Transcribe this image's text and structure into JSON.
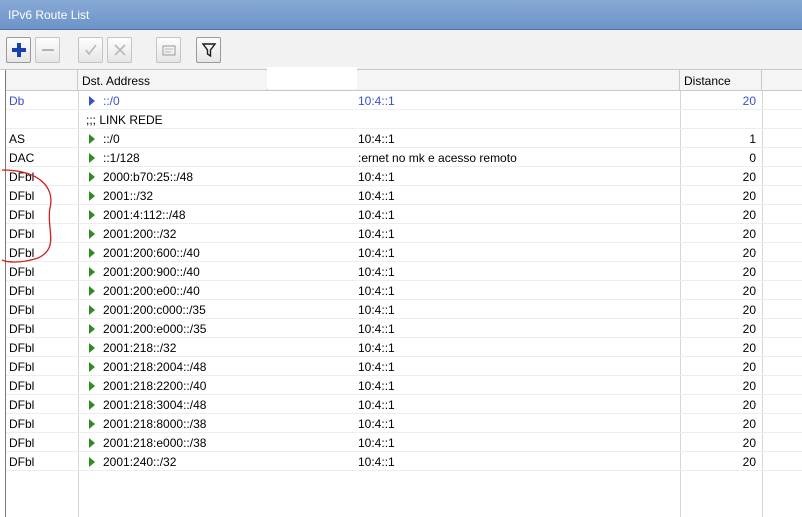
{
  "window": {
    "title": "IPv6 Route List"
  },
  "toolbar": {
    "buttons": [
      {
        "name": "add-button",
        "icon": "plus-icon",
        "enabled": true
      },
      {
        "name": "remove-button",
        "icon": "minus-icon",
        "enabled": false
      },
      {
        "name": "enable-button",
        "icon": "check-icon",
        "enabled": false
      },
      {
        "name": "disable-button",
        "icon": "cross-icon",
        "enabled": false
      },
      {
        "name": "comment-button",
        "icon": "note-icon",
        "enabled": false
      },
      {
        "name": "filter-button",
        "icon": "funnel-icon",
        "enabled": true
      }
    ]
  },
  "table": {
    "headers": {
      "flags": "",
      "dst": "Dst. Address",
      "gateway": "",
      "distance": "Distance"
    },
    "rows": [
      {
        "flags": "Db",
        "dst": "::/0",
        "gateway": "10:4::1",
        "distance": "20",
        "style": "blue"
      },
      {
        "comment": ";;; LINK REDE"
      },
      {
        "flags": "AS",
        "dst": "::/0",
        "gateway": "10:4::1",
        "distance": "1"
      },
      {
        "flags": "DAC",
        "dst": "::1/128",
        "gateway": ":ernet no mk e acesso remoto",
        "distance": "0"
      },
      {
        "flags": "DFbl",
        "dst": "2000:b70:25::/48",
        "gateway": "10:4::1",
        "distance": "20"
      },
      {
        "flags": "DFbl",
        "dst": "2001::/32",
        "gateway": "10:4::1",
        "distance": "20"
      },
      {
        "flags": "DFbl",
        "dst": "2001:4:112::/48",
        "gateway": "10:4::1",
        "distance": "20"
      },
      {
        "flags": "DFbl",
        "dst": "2001:200::/32",
        "gateway": "10:4::1",
        "distance": "20"
      },
      {
        "flags": "DFbl",
        "dst": "2001:200:600::/40",
        "gateway": "10:4::1",
        "distance": "20"
      },
      {
        "flags": "DFbl",
        "dst": "2001:200:900::/40",
        "gateway": "10:4::1",
        "distance": "20"
      },
      {
        "flags": "DFbl",
        "dst": "2001:200:e00::/40",
        "gateway": "10:4::1",
        "distance": "20"
      },
      {
        "flags": "DFbl",
        "dst": "2001:200:c000::/35",
        "gateway": "10:4::1",
        "distance": "20"
      },
      {
        "flags": "DFbl",
        "dst": "2001:200:e000::/35",
        "gateway": "10:4::1",
        "distance": "20"
      },
      {
        "flags": "DFbl",
        "dst": "2001:218::/32",
        "gateway": "10:4::1",
        "distance": "20"
      },
      {
        "flags": "DFbl",
        "dst": "2001:218:2004::/48",
        "gateway": "10:4::1",
        "distance": "20"
      },
      {
        "flags": "DFbl",
        "dst": "2001:218:2200::/40",
        "gateway": "10:4::1",
        "distance": "20"
      },
      {
        "flags": "DFbl",
        "dst": "2001:218:3004::/48",
        "gateway": "10:4::1",
        "distance": "20"
      },
      {
        "flags": "DFbl",
        "dst": "2001:218:8000::/38",
        "gateway": "10:4::1",
        "distance": "20"
      },
      {
        "flags": "DFbl",
        "dst": "2001:218:e000::/38",
        "gateway": "10:4::1",
        "distance": "20"
      },
      {
        "flags": "DFbl",
        "dst": "2001:240::/32",
        "gateway": "10:4::1",
        "distance": "20"
      }
    ]
  },
  "colors": {
    "titlebar": "#7b9fd0",
    "active_route": "#3a4fd6",
    "arrow": "#2e8b22",
    "annotation": "#d42020"
  }
}
